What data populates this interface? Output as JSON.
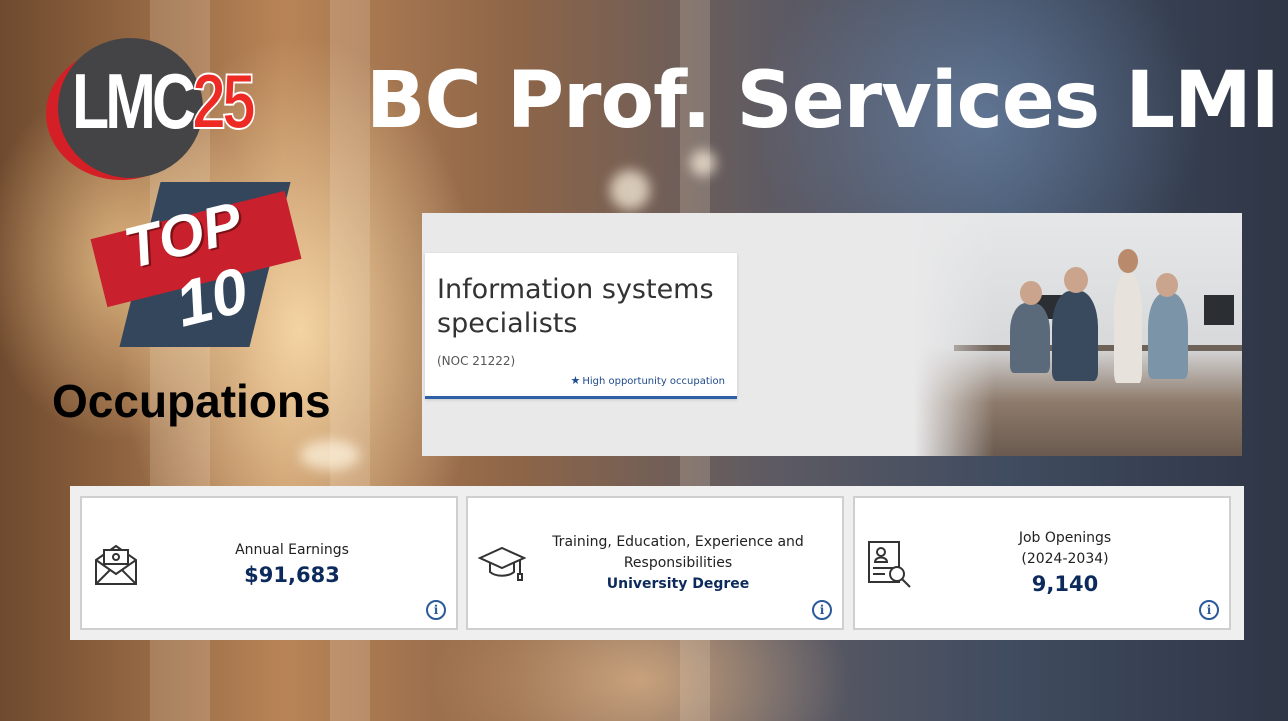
{
  "slide": {
    "title": "BC Prof. Services LMI",
    "logo": {
      "main": "LMC",
      "number": "25"
    },
    "badge": {
      "top": "TOP",
      "number": "10"
    },
    "subtitle": "Occupations"
  },
  "occupation_card": {
    "name": "Information systems specialists",
    "noc": "(NOC 21222)",
    "highlight": "High opportunity occupation",
    "highlight_icon": "star-icon"
  },
  "stats": [
    {
      "label": "Annual Earnings",
      "value": "$91,683",
      "icon": "envelope-money-icon"
    },
    {
      "label": "Training, Education, Experience and Responsibilities",
      "value": "University Degree",
      "icon": "graduation-cap-icon"
    },
    {
      "label": "Job Openings",
      "period": "(2024-2034)",
      "value": "9,140",
      "icon": "resume-search-icon"
    }
  ],
  "info_glyph": "i",
  "colors": {
    "accent_blue": "#2f5fa6",
    "value_navy": "#0c2a5b",
    "logo_red": "#d41f26",
    "logo_grey": "#444446",
    "badge_dark": "#34465c"
  }
}
